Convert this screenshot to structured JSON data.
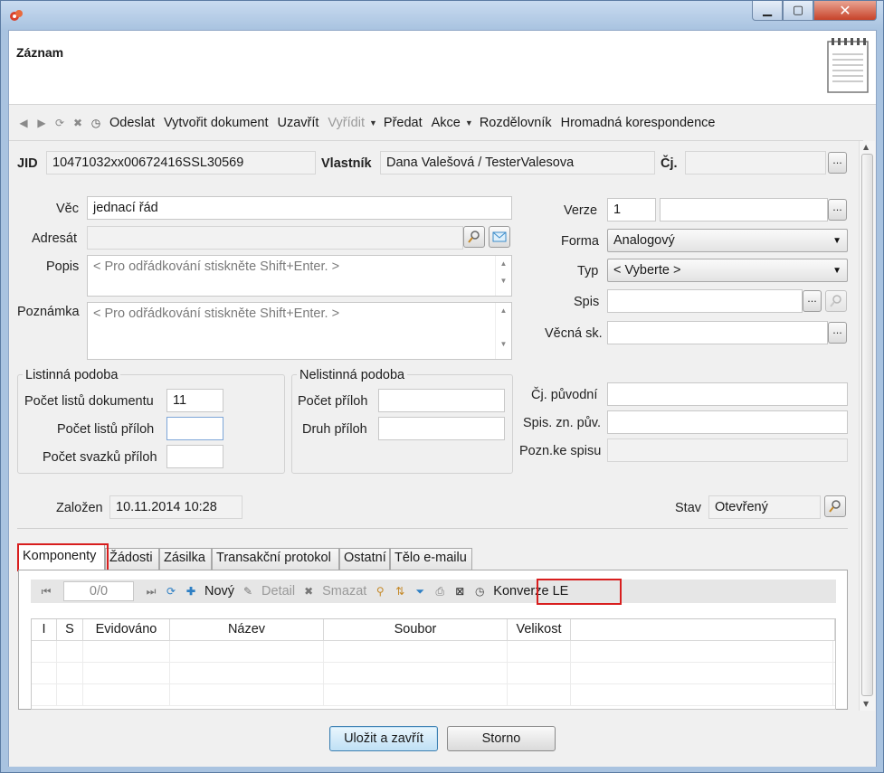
{
  "window": {
    "title": ""
  },
  "header": {
    "title": "Záznam"
  },
  "toolbar": {
    "odeslat": "Odeslat",
    "vytvorit_dokument": "Vytvořit dokument",
    "uzavrit": "Uzavřít",
    "vyridit": "Vyřídit",
    "predat": "Předat",
    "akce": "Akce",
    "rozdelovnik": "Rozdělovník",
    "hromadna": "Hromadná korespondence"
  },
  "record": {
    "jid_label": "JID",
    "jid_value": "10471032xx00672416SSL30569",
    "vlastnik_label": "Vlastník",
    "vlastnik_value": "Dana Valešová / TesterValesova",
    "cj_label": "Čj.",
    "cj_value": ""
  },
  "form": {
    "vec_label": "Věc",
    "vec_value": "jednací řád",
    "adresat_label": "Adresát",
    "adresat_value": "",
    "popis_label": "Popis",
    "popis_placeholder": "< Pro odřádkování stiskněte Shift+Enter. >",
    "poznamka_label": "Poznámka",
    "poznamka_placeholder": "< Pro odřádkování stiskněte Shift+Enter. >",
    "verze_label": "Verze",
    "verze_value": "1",
    "forma_label": "Forma",
    "forma_value": "Analogový",
    "typ_label": "Typ",
    "typ_value": "< Vyberte >",
    "spis_label": "Spis",
    "vecna_label": "Věcná sk.",
    "cj_puvodni_label": "Čj. původní",
    "spis_zn_label": "Spis. zn. pův.",
    "pozn_spisu_label": "Pozn.ke spisu"
  },
  "listinna": {
    "title": "Listinná podoba",
    "pocet_listu_label": "Počet listů dokumentu",
    "pocet_listu_value": "11",
    "pocet_listu_priloh_label": "Počet listů příloh",
    "pocet_svazku_label": "Počet svazků příloh"
  },
  "nelistinna": {
    "title": "Nelistinná podoba",
    "pocet_priloh_label": "Počet příloh",
    "druh_priloh_label": "Druh příloh"
  },
  "status": {
    "zalozen_label": "Založen",
    "zalozen_value": "10.11.2014 10:28",
    "stav_label": "Stav",
    "stav_value": "Otevřený"
  },
  "tabs": [
    "Komponenty",
    "Žádosti",
    "Zásilka",
    "Transakční protokol",
    "Ostatní",
    "Tělo e-mailu"
  ],
  "subtoolbar": {
    "pager": "0/0",
    "novy": "Nový",
    "detail": "Detail",
    "smazat": "Smazat",
    "konverze": "Konverze LE"
  },
  "grid": {
    "columns": [
      "I",
      "S",
      "Evidováno",
      "Název",
      "Soubor",
      "Velikost"
    ]
  },
  "buttons": {
    "save": "Uložit a zavřít",
    "cancel": "Storno"
  }
}
